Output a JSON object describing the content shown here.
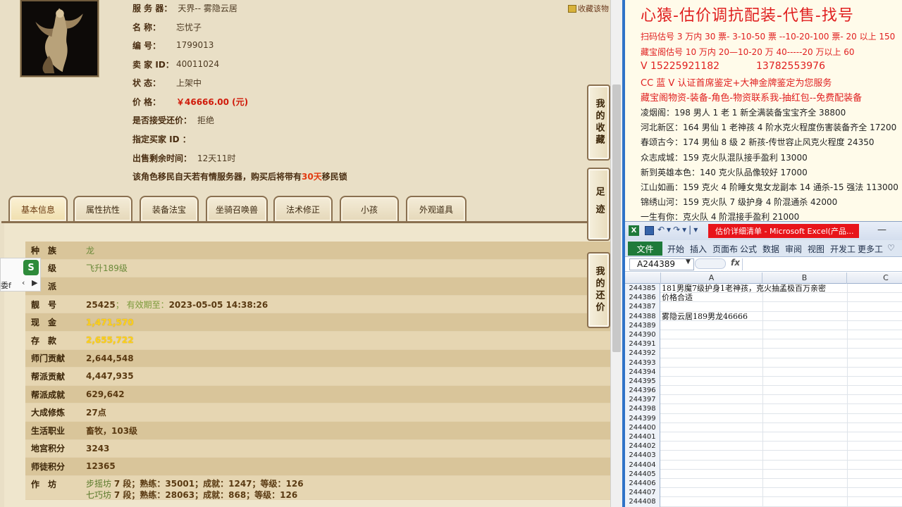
{
  "game": {
    "collect_label": "收藏该物",
    "info": [
      {
        "label": "服 务 器：",
        "value": "天界-- 雾隐云居"
      },
      {
        "label": "名      称：",
        "value": "忘忧子"
      },
      {
        "label": "编      号：",
        "value": "1799013"
      },
      {
        "label": "卖  家  ID：",
        "value": "40011024"
      },
      {
        "label": "状      态：",
        "value": "上架中"
      },
      {
        "label": "价      格：",
        "value": "￥46666.00 (元)"
      },
      {
        "label": "是否接受还价：",
        "value": "拒绝"
      },
      {
        "label": "指定买家 ID ：",
        "value": ""
      },
      {
        "label": "出售剩余时间：",
        "value": "12天11时"
      }
    ],
    "notice_prefix": "该角色移民自天若有情服务器，购买后将带有",
    "notice_days": "30天",
    "notice_suffix": "移民锁",
    "tabs": [
      "基本信息",
      "属性抗性",
      "装备法宝",
      "坐骑召唤兽",
      "法术修正",
      "小孩",
      "外观道具"
    ],
    "side_buttons": [
      "我的收藏",
      "足迹",
      "我的还价"
    ],
    "stats": [
      {
        "key": "种　族",
        "value": "龙"
      },
      {
        "key": "等　级",
        "value": "飞升189级"
      },
      {
        "key": "门　派",
        "value": ""
      },
      {
        "key": "靓　号",
        "value": "25425",
        "sub": "； 有效期至：",
        "extra": "2023-05-05 14:38:26"
      },
      {
        "key": "现　金",
        "value": "1,471,570"
      },
      {
        "key": "存　款",
        "value": "2,655,722"
      },
      {
        "key": "师门贡献",
        "value": "2,644,548"
      },
      {
        "key": "帮派贡献",
        "value": "4,447,935"
      },
      {
        "key": "帮派成就",
        "value": "629,642"
      },
      {
        "key": "大成修炼",
        "value": "27点"
      },
      {
        "key": "生活职业",
        "value": "畜牧，103级"
      },
      {
        "key": "地宫积分",
        "value": "3243"
      },
      {
        "key": "师徒积分",
        "value": "12365"
      }
    ],
    "workshop": {
      "key": "作　坊",
      "lines": [
        {
          "name": "步摇坊",
          "text": "7 段；熟练：35001；成就：1247；等级：126"
        },
        {
          "name": "七巧坊",
          "text": "7 段；熟练：28063；成就：868；等级：126"
        }
      ]
    },
    "overlay": {
      "icon": "S",
      "text": "委f"
    }
  },
  "ad": {
    "title": "心猿-估价调抗配装-代售-找号",
    "lines": [
      {
        "text": "扫码估号 3 万内 30 票- 3-10-50 票  --10-20-100 票- 20 以上 150",
        "red": true
      },
      {
        "text": "藏宝阁估号 10 万内 20—10-20 万 40-----20 万以上 60",
        "red": true
      },
      {
        "text": "V 15225921182",
        "text2": "13782553976",
        "red": true,
        "phone": true
      },
      {
        "text": "CC 蓝 V 认证首席鉴定+大神金牌鉴定为您服务",
        "red": true
      },
      {
        "text": "藏宝阁物资-装备-角色-物资联系我-抽红包--免费配装备",
        "red": true
      },
      {
        "text": "凌烟阁：198 男人 1 老 1 新全满装备宝宝齐全 38800",
        "red": false
      },
      {
        "text": "河北新区：164 男仙 1 老神孩 4 阶水克火程度伤害装备齐全 17200",
        "red": false
      },
      {
        "text": "春颂古今：174 男仙 8 级 2 新孩-传世容止风克火程度 24350",
        "red": false
      },
      {
        "text": "众志成城：159 克火队混队接手盈利 13000",
        "red": false
      },
      {
        "text": "新到英雄本色：140 克火队品像较好 17000",
        "red": false
      },
      {
        "text": "江山如画：159 克火 4 阶睡女鬼女龙副本 14 通杀-15 强法 113000",
        "red": false
      },
      {
        "text": "锦绣山河：159 克火队 7 级护身 4 阶混通杀 42000",
        "red": false
      },
      {
        "text": "一生有你：克火队 4 阶混接手盈利 21000",
        "red": false
      }
    ]
  },
  "excel": {
    "window_title": "估价详细清单 - Microsoft Excel(产品...",
    "file_tab": "文件",
    "tabs": [
      "开始",
      "插入",
      "页面布",
      "公式",
      "数据",
      "审阅",
      "视图",
      "开发工",
      "更多工"
    ],
    "name_box": "A244389",
    "fx": "fx",
    "columns": [
      "A",
      "B",
      "C"
    ],
    "rows": [
      {
        "num": "244385",
        "text": "181男魔7级护身1老神孩，克火抽孟极百万亲密"
      },
      {
        "num": "244386",
        "text": "价格合适"
      },
      {
        "num": "244387",
        "text": ""
      },
      {
        "num": "244388",
        "text": "雾隐云居189男龙46666"
      },
      {
        "num": "244389",
        "text": ""
      },
      {
        "num": "244390",
        "text": ""
      },
      {
        "num": "244391",
        "text": ""
      },
      {
        "num": "244392",
        "text": ""
      },
      {
        "num": "244393",
        "text": ""
      },
      {
        "num": "244394",
        "text": ""
      },
      {
        "num": "244395",
        "text": ""
      },
      {
        "num": "244396",
        "text": ""
      },
      {
        "num": "244397",
        "text": ""
      },
      {
        "num": "244398",
        "text": ""
      },
      {
        "num": "244399",
        "text": ""
      },
      {
        "num": "244400",
        "text": ""
      },
      {
        "num": "244401",
        "text": ""
      },
      {
        "num": "244402",
        "text": ""
      },
      {
        "num": "244403",
        "text": ""
      },
      {
        "num": "244404",
        "text": ""
      },
      {
        "num": "244405",
        "text": ""
      },
      {
        "num": "244406",
        "text": ""
      },
      {
        "num": "244407",
        "text": ""
      },
      {
        "num": "244408",
        "text": ""
      }
    ]
  },
  "colors": {
    "accent_red": "#e02020",
    "excel_green": "#1f7a3a",
    "panel_tan": "#e9dfc6"
  }
}
